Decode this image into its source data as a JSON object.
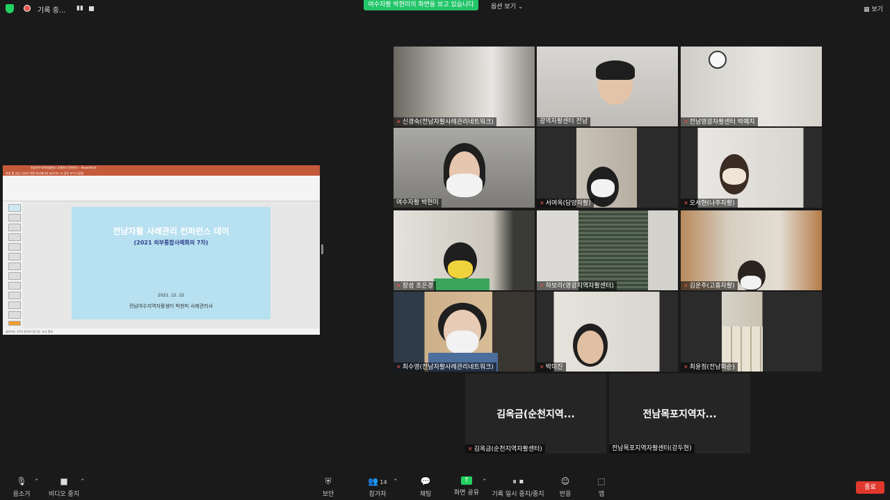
{
  "topbar": {
    "recording_label": "기록 중...",
    "pause_glyph": "▮▮",
    "sharing_banner": "여수자활 박현미의 화면을 보고 있습니다",
    "view_options": "옵션 보기 ⌄",
    "view_button": "보기"
  },
  "shared_screen": {
    "window_title": "전남여수지역자활센터 사례관리 컨퍼런스 - PowerPoint",
    "ribbon_tabs": "파일  홈  삽입  디자인  전환  애니메이션  슬라이드 쇼  검토  보기  도움말",
    "slide_title": "전남자활 사례관리 컨퍼런스 데이",
    "slide_subtitle": "(2021 외부통합사례회의 7차)",
    "slide_date": "2021. 12. 22",
    "slide_org": "전남여수지역자활센터 박현미 사례관리사",
    "status_bar": "슬라이드 1/15   한국어   접근성: 조사 필요"
  },
  "participants": [
    {
      "name": "신경숙(전남자활사례관리네트워크)",
      "muted": true
    },
    {
      "name": "광역자활센터 전남",
      "muted": false
    },
    {
      "name": "전남영광자활센터 박예지",
      "muted": true
    },
    {
      "name": "여수자활 박현미",
      "muted": false,
      "active": true
    },
    {
      "name": "서여옥(담양자활)",
      "muted": true
    },
    {
      "name": "오서현(나주자활)",
      "muted": true
    },
    {
      "name": "장성 조은경",
      "muted": true
    },
    {
      "name": "하보라(영광지역자활센터)",
      "muted": true
    },
    {
      "name": "김운주(고흥자활)",
      "muted": true
    },
    {
      "name": "최수영(전남자활사례관리네트워크)",
      "muted": true
    },
    {
      "name": "박미진",
      "muted": true
    },
    {
      "name": "최윤정(전남화순)",
      "muted": true
    }
  ],
  "name_only_tiles": [
    {
      "big": "김옥금(순천지역...",
      "name": "김옥금(순천지역자활센터)",
      "muted": true
    },
    {
      "big": "전남목포지역자...",
      "name": "전남목포지역자활센터(강두현)",
      "muted": false
    }
  ],
  "toolbar": {
    "mute": "음소거",
    "stop_video": "비디오 중지",
    "security": "보안",
    "participants": "참가자",
    "participants_count": "14",
    "chat": "채팅",
    "share_screen": "화면 공유",
    "recording": "기록 일시 중지/중지",
    "reactions": "반응",
    "apps": "앱",
    "end": "종료"
  },
  "colors": {
    "banner_green": "#23c56a",
    "active_speaker": "#d4e157",
    "end_red": "#e0382d"
  }
}
